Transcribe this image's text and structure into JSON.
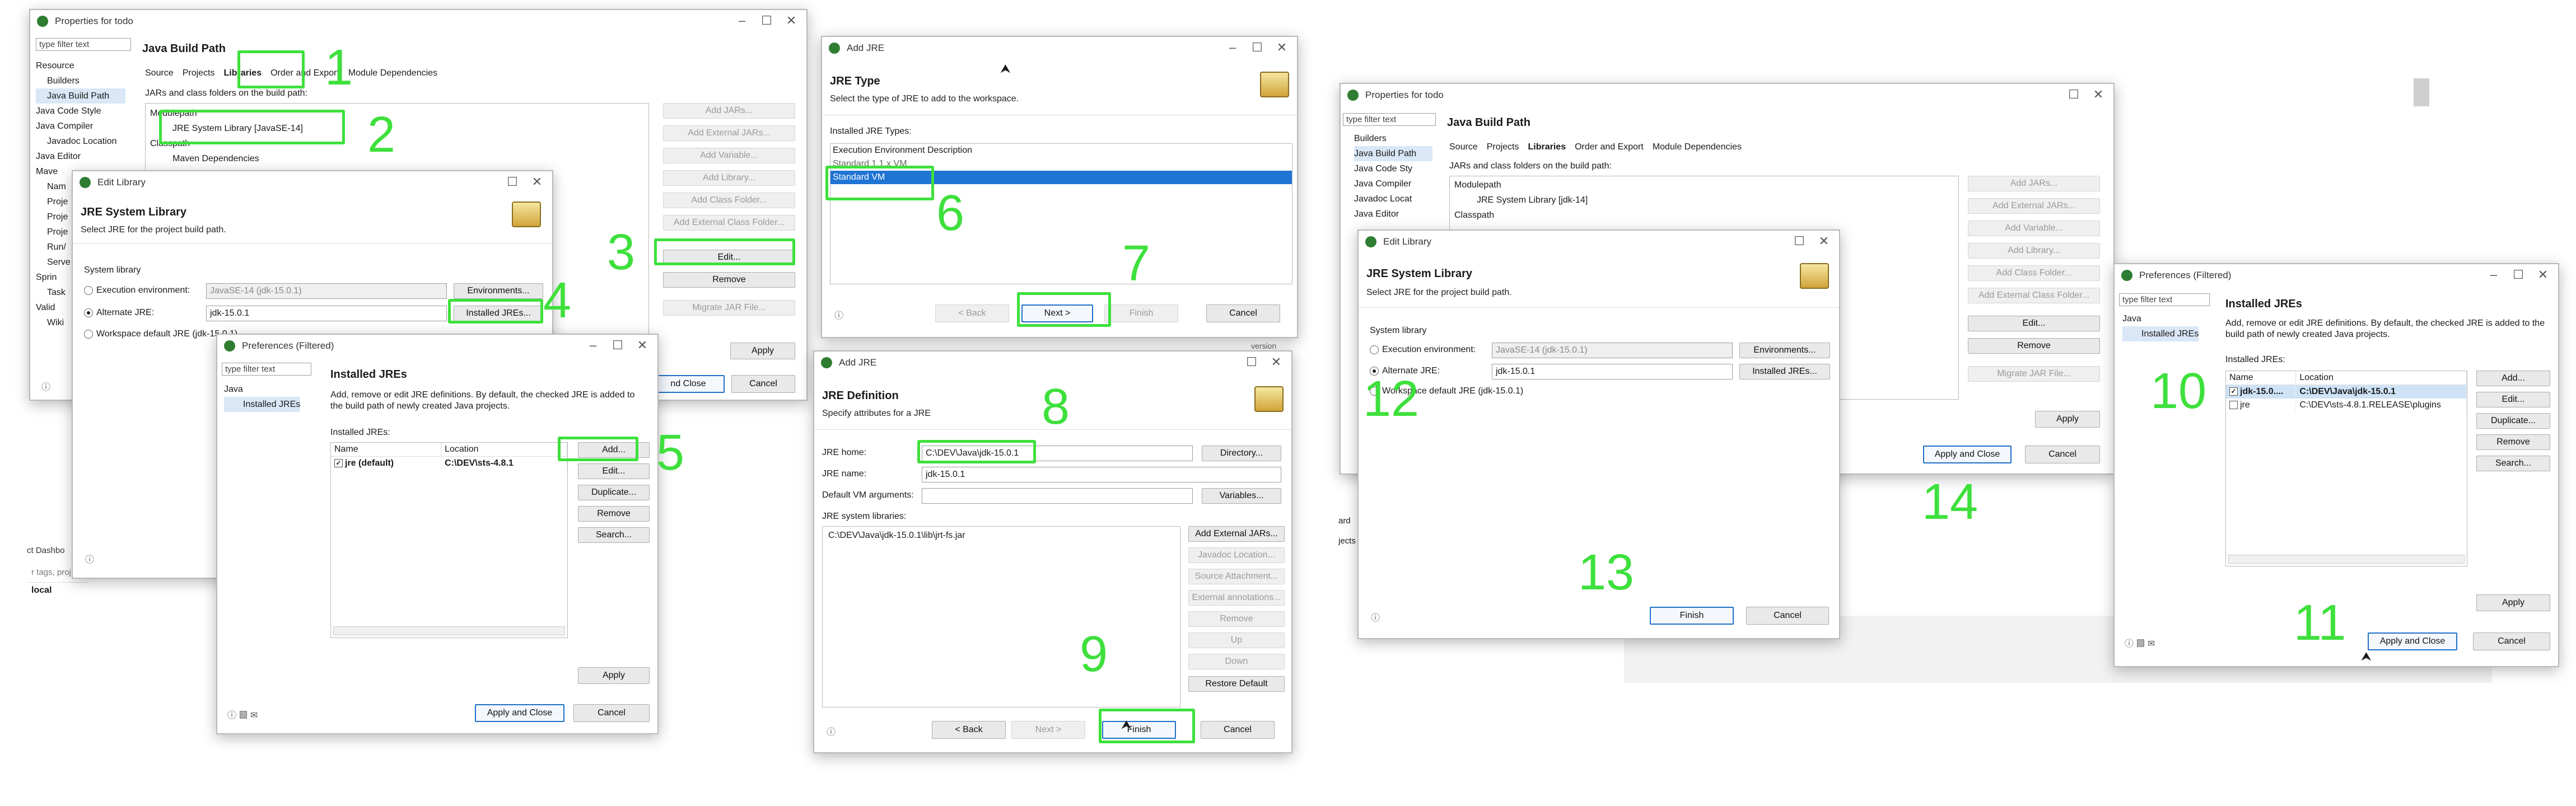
{
  "w1": {
    "title": "Properties for todo",
    "filter": "type filter text",
    "tree": [
      "Resource",
      "Builders",
      "Java Build Path",
      "Java Code Style",
      "Java Compiler",
      "Javadoc Location",
      "Java Editor",
      "Mave",
      "Nam",
      "Proje",
      "Proje",
      "Proje",
      "Run/",
      "Serve",
      "Sprin",
      "Task",
      "Valid",
      "Wiki"
    ],
    "heading": "Java Build Path",
    "tabs": [
      "Source",
      "Projects",
      "Libraries",
      "Order and Export",
      "Module Dependencies"
    ],
    "desc": "JARs and class folders on the build path:",
    "list": [
      "Modulepath",
      "JRE System Library [JavaSE-14]",
      "Classpath",
      "Maven Dependencies"
    ],
    "buttons": [
      "Add JARs...",
      "Add External JARs...",
      "Add Variable...",
      "Add Library...",
      "Add Class Folder...",
      "Add External Class Folder...",
      "Edit...",
      "Remove",
      "Migrate JAR File..."
    ],
    "apply": "Apply",
    "apply_close": "nd Close",
    "cancel": "Cancel"
  },
  "w2": {
    "title": "Edit Library",
    "heading": "JRE System Library",
    "sub": "Select JRE for the project build path.",
    "group": "System library",
    "env_label": "Execution environment:",
    "env_value": "JavaSE-14 (jdk-15.0.1)",
    "env_btn": "Environments...",
    "alt_label": "Alternate JRE:",
    "alt_value": "jdk-15.0.1",
    "alt_btn": "Installed JREs...",
    "ws_label": "Workspace default JRE (jdk-15.0.1)"
  },
  "w3": {
    "title": "Preferences (Filtered)",
    "filter": "type filter text",
    "tree": [
      "Java",
      "Installed JREs"
    ],
    "heading": "Installed JREs",
    "desc": "Add, remove or edit JRE definitions. By default, the checked JRE is added to the build path of newly created Java projects.",
    "list_label": "Installed JREs:",
    "col_name": "Name",
    "col_loc": "Location",
    "rows": [
      {
        "name": "jre (default)",
        "loc": "C:\\DEV\\sts-4.8.1"
      }
    ],
    "buttons": [
      "Add...",
      "Edit...",
      "Duplicate...",
      "Remove",
      "Search..."
    ],
    "apply": "Apply",
    "apply_close": "Apply and Close",
    "cancel": "Cancel"
  },
  "w4": {
    "title": "Add JRE",
    "heading": "JRE Type",
    "sub": "Select the type of JRE to add to the workspace.",
    "list_label": "Installed JRE Types:",
    "types": [
      "Execution Environment Description",
      "Standard 1.1.x VM",
      "Standard VM"
    ],
    "back": "< Back",
    "next": "Next >",
    "finish": "Finish",
    "cancel": "Cancel"
  },
  "w5": {
    "title": "Add JRE",
    "heading": "JRE Definition",
    "sub": "Specify attributes for a JRE",
    "home_label": "JRE home:",
    "home_value": "C:\\DEV\\Java\\jdk-15.0.1",
    "dir_btn": "Directory...",
    "name_label": "JRE name:",
    "name_value": "jdk-15.0.1",
    "args_label": "Default VM arguments:",
    "var_btn": "Variables...",
    "libs_label": "JRE system libraries:",
    "lib": "C:\\DEV\\Java\\jdk-15.0.1\\lib\\jrt-fs.jar",
    "buttons": [
      "Add External JARs...",
      "Javadoc Location...",
      "Source Attachment...",
      "External annotations...",
      "Remove",
      "Up",
      "Down",
      "Restore Default"
    ],
    "back": "< Back",
    "next": "Next >",
    "finish": "Finish",
    "cancel": "Cancel",
    "behind": "version"
  },
  "bg": {
    "left1": "ct Dashbo",
    "left2": "r tags, proj",
    "left3": "local",
    "left4": "ard",
    "left5": "jects"
  },
  "w6": {
    "title": "Properties for todo",
    "filter": "type filter text",
    "tree": [
      "Builders",
      "Java Build Path",
      "Java Code Sty",
      "Java Compiler",
      "Javadoc Locat",
      "Java Editor"
    ],
    "heading": "Java Build Path",
    "tabs": [
      "Source",
      "Projects",
      "Libraries",
      "Order and Export",
      "Module Dependencies"
    ],
    "desc": "JARs and class folders on the build path:",
    "list": [
      "Modulepath",
      "JRE System Library [jdk-14]",
      "Classpath"
    ],
    "buttons": [
      "Add JARs...",
      "Add External JARs...",
      "Add Variable...",
      "Add Library...",
      "Add Class Folder...",
      "Add External Class Folder...",
      "Edit...",
      "Remove",
      "Migrate JAR File..."
    ],
    "apply": "Apply",
    "apply_close": "Apply and Close",
    "cancel": "Cancel"
  },
  "w7": {
    "title": "Edit Library",
    "heading": "JRE System Library",
    "sub": "Select JRE for the project build path.",
    "group": "System library",
    "env_label": "Execution environment:",
    "env_value": "JavaSE-14 (jdk-15.0.1)",
    "env_btn": "Environments...",
    "alt_label": "Alternate JRE:",
    "alt_value": "jdk-15.0.1",
    "alt_btn": "Installed JREs...",
    "ws_label": "Workspace default JRE (jdk-15.0.1)",
    "finish": "Finish",
    "cancel": "Cancel"
  },
  "w8": {
    "title": "Preferences (Filtered)",
    "filter": "type filter text",
    "tree": [
      "Java",
      "Installed JREs"
    ],
    "heading": "Installed JREs",
    "desc": "Add, remove or edit JRE definitions. By default, the checked JRE is added to the build path of newly created Java projects.",
    "list_label": "Installed JREs:",
    "col_name": "Name",
    "col_loc": "Location",
    "rows": [
      {
        "name": "jdk-15.0....",
        "loc": "C:\\DEV\\Java\\jdk-15.0.1"
      },
      {
        "name": "jre",
        "loc": "C:\\DEV\\sts-4.8.1.RELEASE\\plugins"
      }
    ],
    "buttons": [
      "Add...",
      "Edit...",
      "Duplicate...",
      "Remove",
      "Search..."
    ],
    "apply": "Apply",
    "apply_close": "Apply and Close",
    "cancel": "Cancel"
  },
  "steps": [
    "1",
    "2",
    "3",
    "4",
    "5",
    "6",
    "7",
    "8",
    "9",
    "10",
    "11",
    "12",
    "13",
    "14"
  ],
  "colors": {
    "annotation": "#3ee03c",
    "selection": "#1f74d4"
  }
}
